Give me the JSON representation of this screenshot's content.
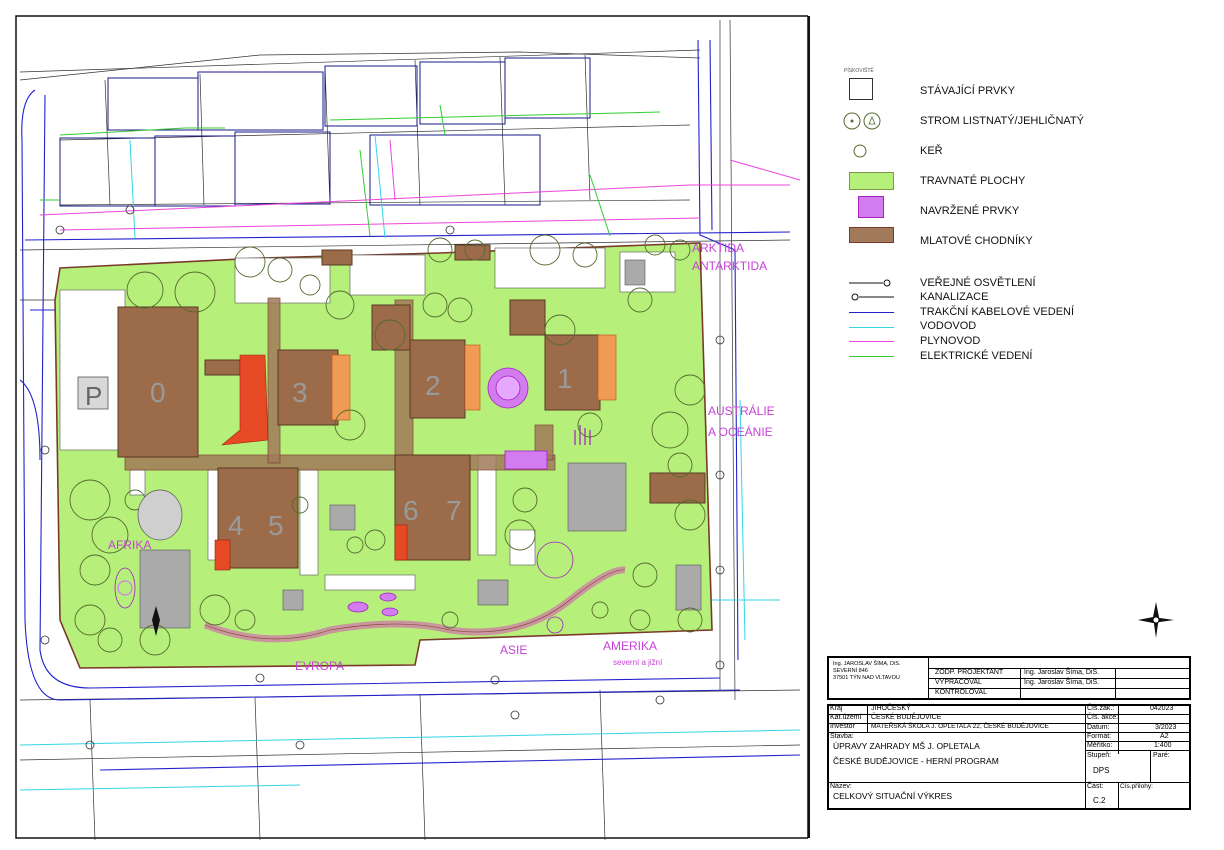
{
  "map": {
    "continent_labels": {
      "arktida": "ARKTIDA\nANTARKTIDA",
      "australie": "AUSTRÁLIE\nA OCEÁNIE",
      "afrika": "AFRIKA",
      "evropa": "EVROPA",
      "asie": "ASIE",
      "amerika": "AMERIKA",
      "amerika_sub": "severní a jižní"
    },
    "building_numbers": [
      "0",
      "3",
      "2",
      "1",
      "4",
      "5",
      "6",
      "7"
    ],
    "parking": "P",
    "colors": {
      "grass": "#b6f07a",
      "building": "#9b6b4a",
      "path": "#a07a5a",
      "designed": "#d27cf0",
      "boundary": "#7a3a2a",
      "cable": "#2222cc",
      "water": "#33d6e6",
      "gas": "#ee44dd",
      "electric": "#33cc33",
      "paving": "#aaaaaa",
      "continent_text": "#c740d8"
    }
  },
  "legend": {
    "piskoviste": "PÍSKOVIŠTĚ",
    "items": [
      {
        "label": "STÁVAJÍCÍ PRVKY",
        "icon": "existing-element-icon"
      },
      {
        "label": "STROM LISTNATÝ/JEHLIČNATÝ",
        "icon": "tree-icon"
      },
      {
        "label": "KEŘ",
        "icon": "shrub-icon"
      },
      {
        "label": "TRAVNATÉ PLOCHY",
        "icon": "grass-area-icon"
      },
      {
        "label": "NAVRŽENÉ PRVKY",
        "icon": "designed-element-icon"
      },
      {
        "label": "MLATOVÉ CHODNÍKY",
        "icon": "gravel-path-icon"
      }
    ],
    "lines": [
      {
        "label": "VEŘEJNÉ OSVĚTLENÍ",
        "color": "#111111"
      },
      {
        "label": "KANALIZACE",
        "color": "#111111"
      },
      {
        "label": "TRAKČNÍ KABELOVÉ VEDENÍ",
        "color": "#2222cc"
      },
      {
        "label": "VODOVOD",
        "color": "#33d6e6"
      },
      {
        "label": "PLYNOVOD",
        "color": "#ee44dd"
      },
      {
        "label": "ELEKTRICKÉ VEDENÍ",
        "color": "#33cc33"
      }
    ]
  },
  "titleblock": {
    "author_lines": [
      "Ing. JAROSLAV ŠÍMA, DiS.",
      "SEVERNÍ 846",
      "37501 TÝN NAD VLTAVOU"
    ],
    "roles": [
      {
        "role": "ZODP. PROJEKTANT",
        "name": "Ing. Jaroslav Šíma, DiS."
      },
      {
        "role": "VYPRACOVAL",
        "name": "Ing. Jaroslav Šíma, DiS."
      },
      {
        "role": "KONTROLOVAL",
        "name": ""
      }
    ],
    "kraj_label": "Kraj",
    "kraj": "JIHOČESKÝ",
    "katuzemi_label": "Kat.území",
    "katuzemi": "ČESKÉ BUDĚJOVICE",
    "investor_label": "Investor",
    "investor": "MATEŘSKÁ ŠKOLA J. OPLETALA 22, ČESKÉ BUDĚJOVICE",
    "stavba_label": "Stavba:",
    "stavba_1": "ÚPRAVY ZAHRADY MŠ J. OPLETALA",
    "stavba_2": "ČESKÉ BUDĚJOVICE - HERNÍ PROGRAM",
    "nazev_label": "Název:",
    "nazev": "CELKOVÝ SITUAČNÍ VÝKRES",
    "cis_zak_label": "Čís.zak.:",
    "cis_zak": "042023",
    "cis_akce_label": "Čís. akce:",
    "cis_akce": "",
    "datum_label": "Datum:",
    "datum": "3/2023",
    "format_label": "Formát:",
    "format": "A2",
    "meritko_label": "Měřítko:",
    "meritko": "1:400",
    "stupen_label": "Stupeň:",
    "stupen": "DPS",
    "pare_label": "Paré:",
    "cast_label": "Část:",
    "cast": "C.2",
    "cis_prilohy_label": "Čís.přílohy:"
  }
}
